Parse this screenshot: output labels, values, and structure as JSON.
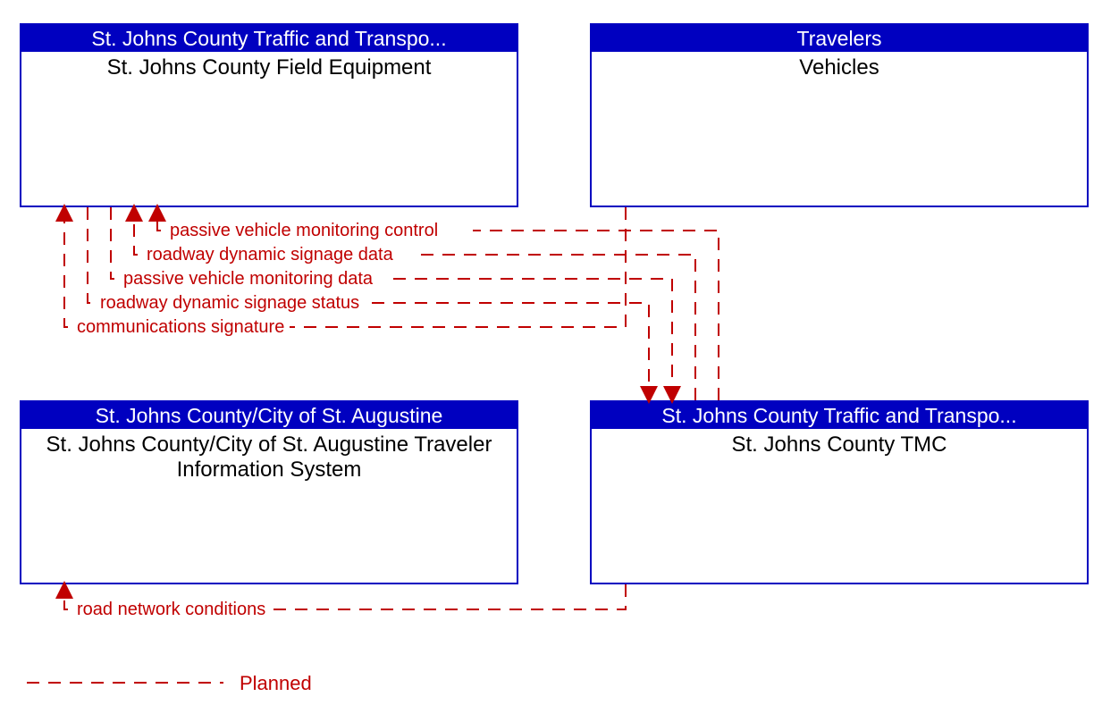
{
  "nodes": {
    "top_left": {
      "header": "St. Johns County Traffic and Transpo...",
      "body": "St. Johns County Field Equipment"
    },
    "top_right": {
      "header": "Travelers",
      "body": "Vehicles"
    },
    "bottom_left": {
      "header": "St. Johns County/City of St. Augustine",
      "body": "St. Johns County/City of St. Augustine Traveler Information System"
    },
    "bottom_right": {
      "header": "St. Johns County Traffic and Transpo...",
      "body": "St. Johns County TMC"
    }
  },
  "flows": {
    "f1": "passive vehicle monitoring control",
    "f2": "roadway dynamic signage data",
    "f3": "passive vehicle monitoring data",
    "f4": "roadway dynamic signage status",
    "f5": "communications signature",
    "f6": "road network conditions"
  },
  "legend": {
    "planned": "Planned"
  },
  "colors": {
    "planned": "#c00000",
    "node_border": "#0000c0",
    "node_header_bg": "#0000c0",
    "node_header_fg": "#ffffff"
  }
}
